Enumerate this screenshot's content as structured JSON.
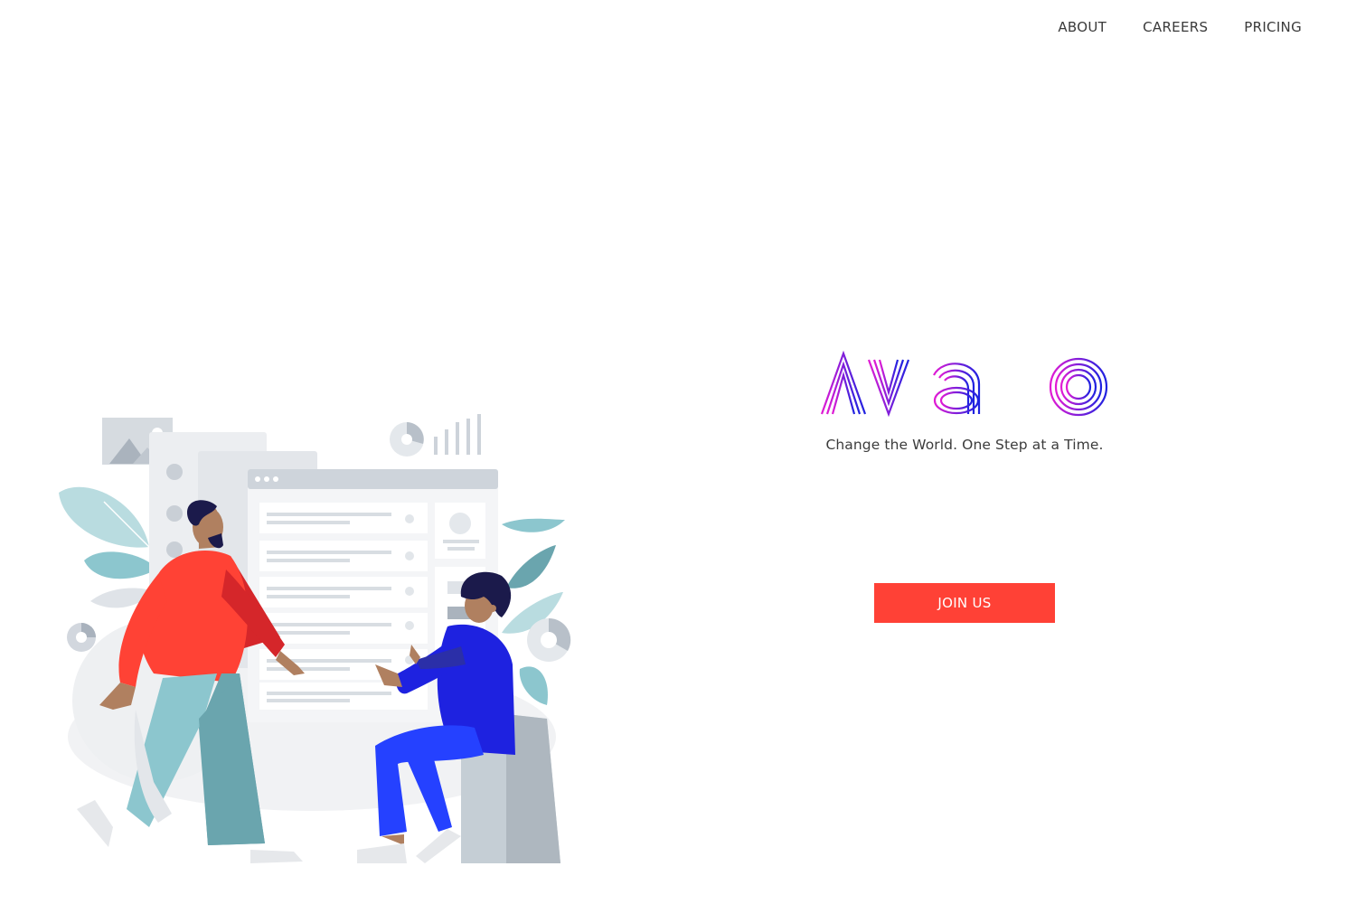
{
  "nav": {
    "items": [
      {
        "label": "ABOUT"
      },
      {
        "label": "CAREERS"
      },
      {
        "label": "PRICING"
      }
    ]
  },
  "hero": {
    "logo_text": "AVIATO",
    "tagline": "Change the World. One Step at a Time.",
    "cta_label": "JOIN US"
  },
  "colors": {
    "background": "#ffffff",
    "accent": "#ff4136",
    "logo_gradient_start": "#e21bd4",
    "logo_gradient_end": "#1e22e0",
    "text": "#3a3a3a"
  },
  "icons": [
    "team-collaboration-illustration"
  ]
}
